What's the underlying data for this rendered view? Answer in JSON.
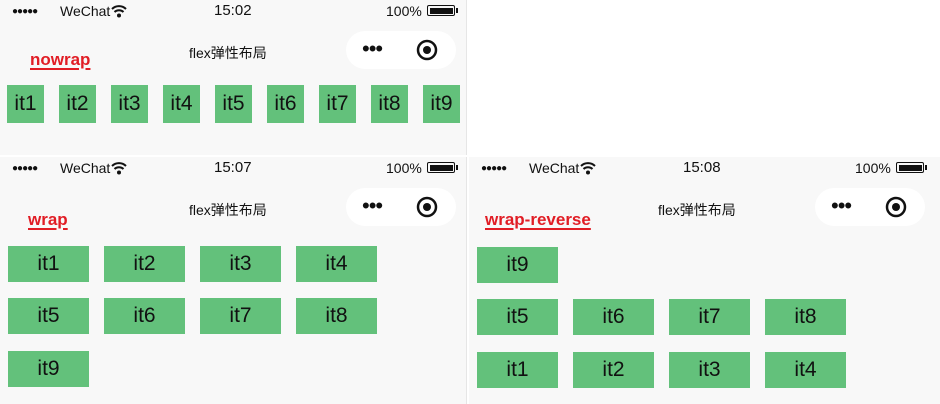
{
  "status_bar": {
    "signal": "●●●●●",
    "carrier": "WeChat",
    "battery": "100%"
  },
  "panels": [
    {
      "time": "15:02",
      "title": "flex弹性布局",
      "mode": "nowrap",
      "items": [
        "it1",
        "it2",
        "it3",
        "it4",
        "it5",
        "it6",
        "it7",
        "it8",
        "it9"
      ]
    },
    {
      "time": "15:07",
      "title": "flex弹性布局",
      "mode": "wrap",
      "items": [
        "it1",
        "it2",
        "it3",
        "it4",
        "it5",
        "it6",
        "it7",
        "it8",
        "it9"
      ]
    },
    {
      "time": "15:08",
      "title": "flex弹性布局",
      "mode": "wrap-reverse",
      "items": [
        "it1",
        "it2",
        "it3",
        "it4",
        "it5",
        "it6",
        "it7",
        "it8",
        "it9"
      ]
    }
  ],
  "colors": {
    "item_green": "#63c17b",
    "label_red": "#e11d25",
    "background": "#f8f8f8"
  },
  "icons": {
    "wifi": "wifi-icon",
    "battery": "battery-icon",
    "more": "more-dots-icon",
    "target": "target-icon"
  }
}
